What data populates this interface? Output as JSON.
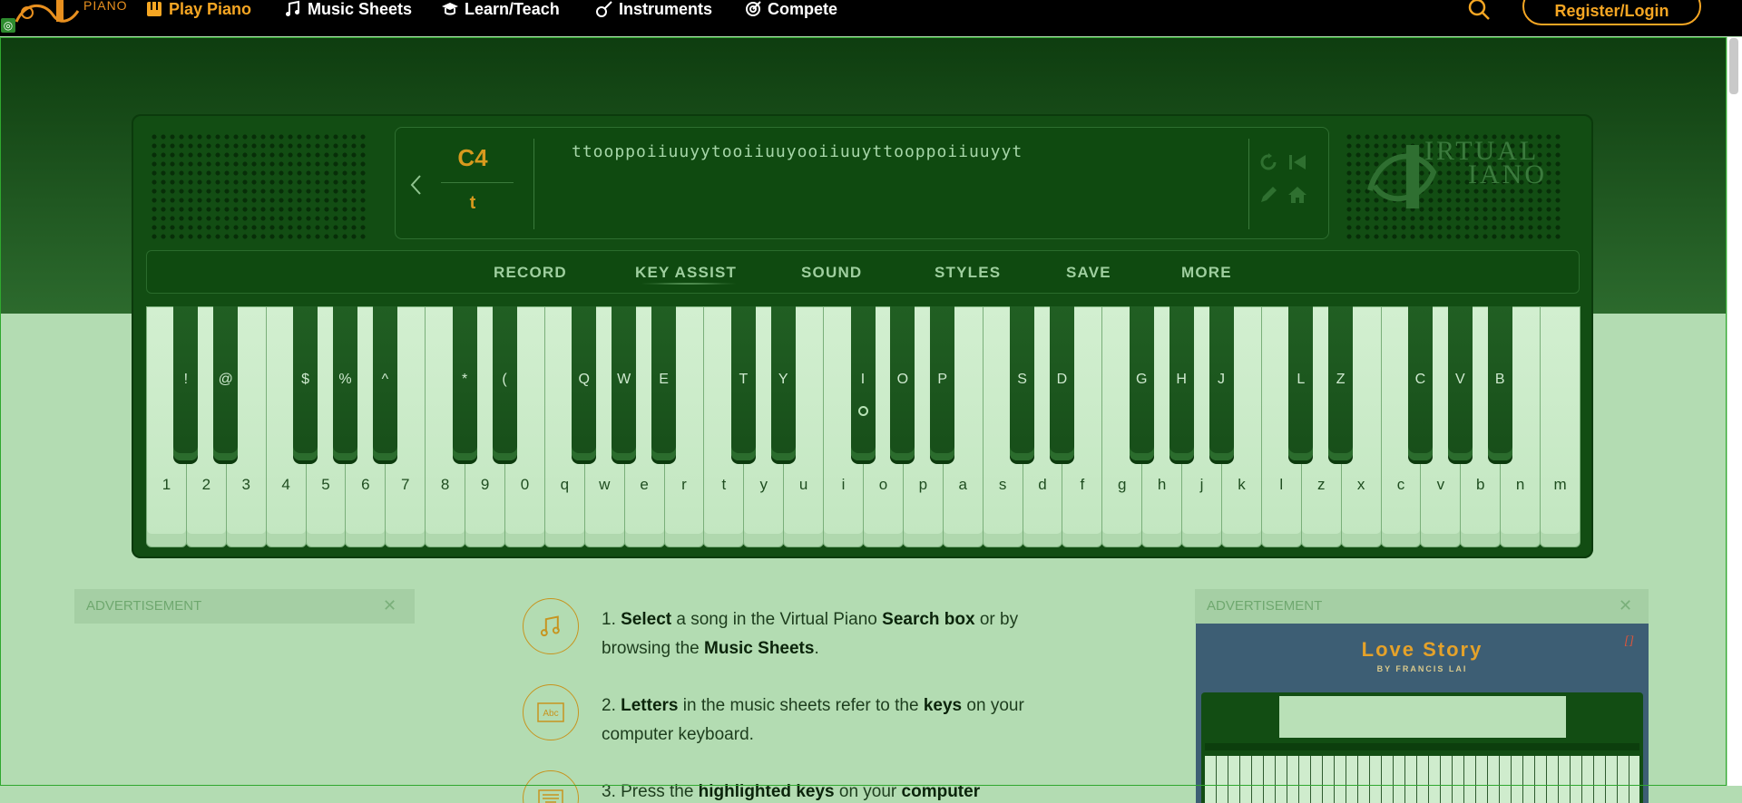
{
  "nav": {
    "logo_text": "PIANO",
    "items": [
      {
        "label": "Play Piano",
        "icon": "piano-icon",
        "active": true
      },
      {
        "label": "Music Sheets",
        "icon": "music-notes-icon"
      },
      {
        "label": "Learn/Teach",
        "icon": "graduation-cap-icon"
      },
      {
        "label": "Instruments",
        "icon": "guitar-icon"
      },
      {
        "label": "Compete",
        "icon": "target-icon"
      }
    ],
    "register_label": "Register/Login"
  },
  "brand": {
    "line1": "IRTUAL",
    "line2": "IANO"
  },
  "display": {
    "note": "C4",
    "key": "t",
    "song_text": "ttooppoiiuuyytooiiuuyooiiuuyttooppoiiuuyyt"
  },
  "toolbar": {
    "items": [
      "RECORD",
      "KEY ASSIST",
      "SOUND",
      "STYLES",
      "SAVE",
      "MORE"
    ],
    "active": "KEY ASSIST"
  },
  "keyboard": {
    "white_keys": [
      "1",
      "2",
      "3",
      "4",
      "5",
      "6",
      "7",
      "8",
      "9",
      "0",
      "q",
      "w",
      "e",
      "r",
      "t",
      "y",
      "u",
      "i",
      "o",
      "p",
      "a",
      "s",
      "d",
      "f",
      "g",
      "h",
      "j",
      "k",
      "l",
      "z",
      "x",
      "c",
      "v",
      "b",
      "n",
      "m"
    ],
    "black_keys": [
      {
        "after": 0,
        "label": "!"
      },
      {
        "after": 1,
        "label": "@"
      },
      {
        "after": 3,
        "label": "$"
      },
      {
        "after": 4,
        "label": "%"
      },
      {
        "after": 5,
        "label": "^"
      },
      {
        "after": 7,
        "label": "*"
      },
      {
        "after": 8,
        "label": "("
      },
      {
        "after": 10,
        "label": "Q"
      },
      {
        "after": 11,
        "label": "W"
      },
      {
        "after": 12,
        "label": "E"
      },
      {
        "after": 14,
        "label": "T"
      },
      {
        "after": 15,
        "label": "Y"
      },
      {
        "after": 17,
        "label": "I",
        "hint": true
      },
      {
        "after": 18,
        "label": "O"
      },
      {
        "after": 19,
        "label": "P"
      },
      {
        "after": 21,
        "label": "S"
      },
      {
        "after": 22,
        "label": "D"
      },
      {
        "after": 24,
        "label": "G"
      },
      {
        "after": 25,
        "label": "H"
      },
      {
        "after": 26,
        "label": "J"
      },
      {
        "after": 28,
        "label": "L"
      },
      {
        "after": 29,
        "label": "Z"
      },
      {
        "after": 31,
        "label": "C"
      },
      {
        "after": 32,
        "label": "V"
      },
      {
        "after": 33,
        "label": "B"
      }
    ]
  },
  "ads": {
    "label": "ADVERTISEMENT",
    "close": "✕"
  },
  "instructions": {
    "step1": {
      "a": "1. ",
      "b1": "Select",
      "c": " a song in the Virtual Piano ",
      "b2": "Search box",
      "d": " or by browsing the ",
      "b3": "Music Sheets",
      "e": "."
    },
    "step2": {
      "a": "2. ",
      "b1": "Letters",
      "c": " in the music sheets refer to the ",
      "b2": "keys",
      "d": " on your computer keyboard."
    },
    "step3": {
      "a": "3. Press the ",
      "b1": "highlighted keys",
      "c": " on your ",
      "b2": "computer"
    }
  },
  "promo": {
    "title": "Love Story",
    "subtitle": "BY FRANCIS LAI",
    "corner": "[]"
  },
  "colors": {
    "accent": "#f5a623",
    "piano_body": "#124d13",
    "page_bg": "#b3dcb2"
  }
}
